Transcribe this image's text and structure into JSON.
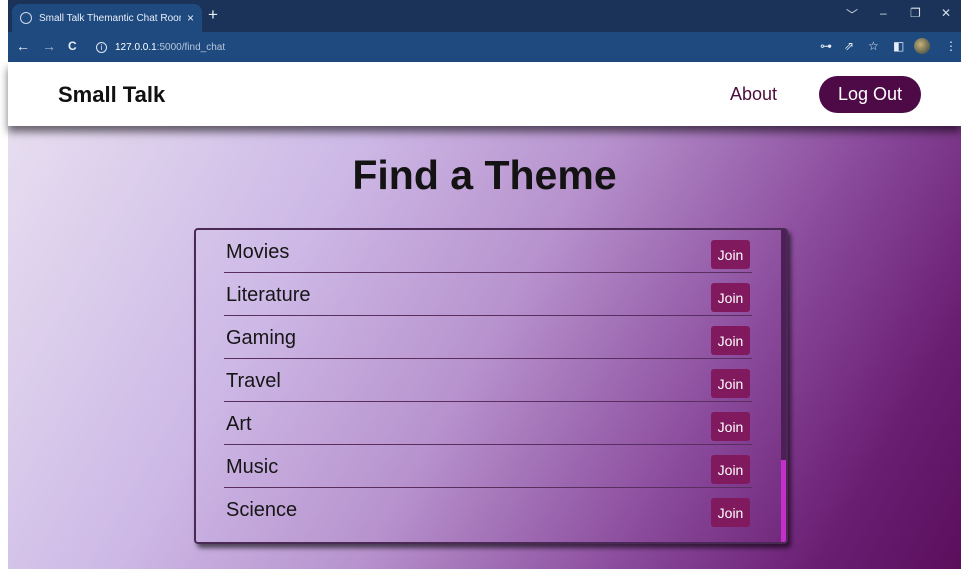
{
  "browser": {
    "tab_title": "Small Talk Themantic Chat Room",
    "tab_close": "×",
    "new_tab": "+",
    "url_host": "127.0.0.1",
    "url_path": ":5000/find_chat",
    "window_controls": [
      "﹀",
      "–",
      "❐",
      "✕"
    ],
    "nav": {
      "back": "←",
      "forward": "→",
      "reload": "C",
      "info": "i"
    },
    "toolbar_icons": {
      "key": "⊶",
      "share": "⇗",
      "star": "☆",
      "sidepanel": "◧",
      "menu": "⋮"
    }
  },
  "header": {
    "brand": "Small Talk",
    "about": "About",
    "logout": "Log Out"
  },
  "main": {
    "title": "Find a Theme",
    "join_label": "Join",
    "themes": [
      "Movies",
      "Literature",
      "Gaming",
      "Travel",
      "Art",
      "Music",
      "Science"
    ]
  },
  "colors": {
    "header_button": "#4e0a46",
    "join_button": "#80195e",
    "scroll_thumb": "#c42ec9"
  }
}
